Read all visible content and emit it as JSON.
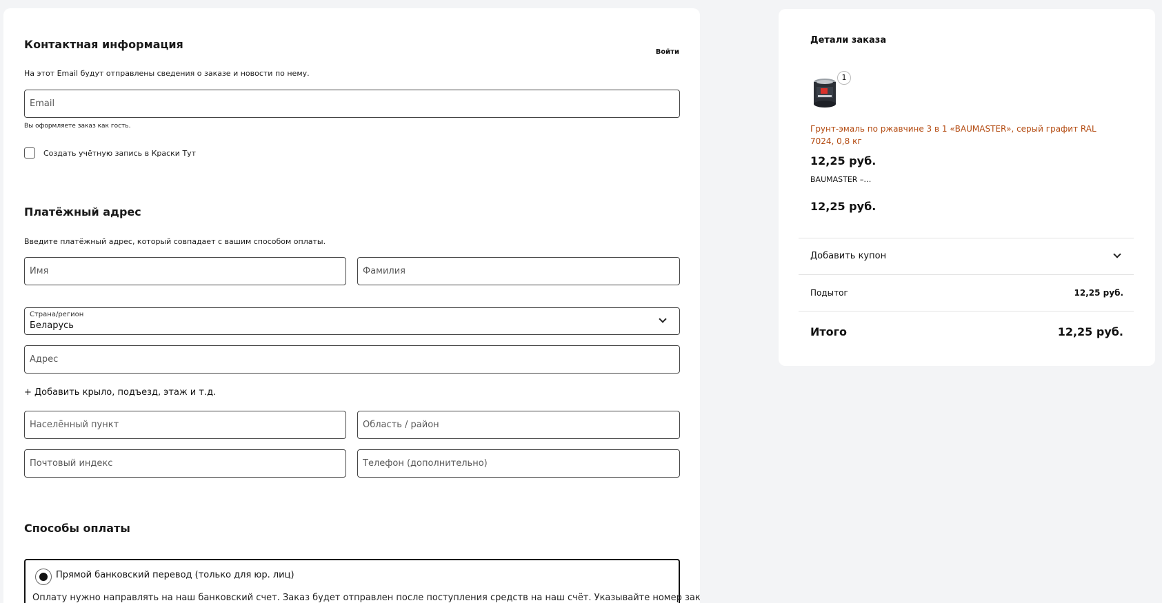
{
  "contact": {
    "title": "Контактная информация",
    "login": "Войти",
    "note": "На этот Email будут отправлены сведения о заказе и новости по нему.",
    "email_placeholder": "Email",
    "guest_note": "Вы оформляете заказ как гость.",
    "create_account_label": "Создать учётную запись в Краски Тут",
    "create_account_checked": false
  },
  "billing": {
    "title": "Платёжный адрес",
    "note": "Введите платёжный адрес, который совпадает с вашим способом оплаты.",
    "first_name_placeholder": "Имя",
    "last_name_placeholder": "Фамилия",
    "country_label": "Страна/регион",
    "country_value": "Беларусь",
    "address_placeholder": "Адрес",
    "add_more_link": "+ Добавить крыло, подъезд, этаж и т.д.",
    "city_placeholder": "Населённый пункт",
    "region_placeholder": "Область / район",
    "postcode_placeholder": "Почтовый индекс",
    "phone_placeholder": "Телефон (дополнительно)"
  },
  "payment": {
    "title": "Способы оплаты",
    "method_label": "Прямой банковский перевод (только для юр. лиц)",
    "method_selected": true,
    "method_description": "Оплату нужно направлять на наш банковский счет. Заказ будет отправлен после поступления средств на наш счёт. Указывайте номер заказа в"
  },
  "order": {
    "title": "Детали заказа",
    "item": {
      "quantity": "1",
      "name": "Грунт-эмаль по ржавчине 3 в 1 «BAUMASTER», серый графит RAL 7024, 0,8 кг",
      "unit_price": "12,25 руб.",
      "brand_excerpt": "BAUMASTER –…",
      "line_total": "12,25 руб."
    },
    "coupon_label": "Добавить купон",
    "subtotal_label": "Подытог",
    "subtotal_value": "12,25 руб.",
    "total_label": "Итого",
    "total_value": "12,25 руб."
  },
  "colors": {
    "product_link": "#b34a10",
    "page_background": "#f3f4f6"
  }
}
